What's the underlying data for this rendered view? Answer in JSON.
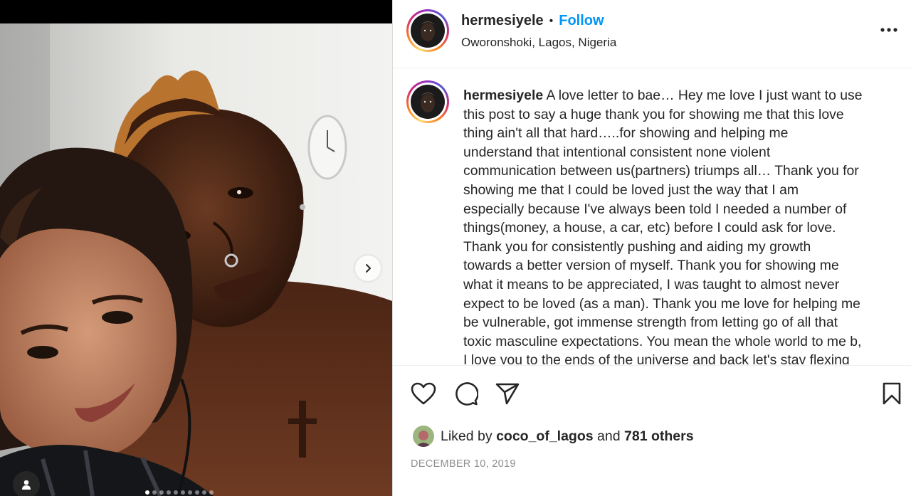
{
  "post": {
    "username": "hermesiyele",
    "follow_label": "Follow",
    "separator": "•",
    "location": "Oworonshoki, Lagos, Nigeria",
    "caption_text": "A love letter to bae… Hey me love I just want to use\nthis post to say a huge thank you for showing me that this love\nthing ain't all that hard…..for showing and helping me\nunderstand that intentional consistent none violent\ncommunication between us(partners) triumps all… Thank you for\nshowing me that I could be loved just the way that I am\nespecially because I've always been told I needed a number of\nthings(money, a house, a car, etc) before I could ask for love.\nThank you for consistently pushing and aiding my growth\ntowards a better version of myself. Thank you for showing me\nwhat it means to be appreciated, I was taught to almost never\nexpect to be loved (as a man). Thank you me love for helping me\nbe vulnerable, got immense strength from letting go of all that\ntoxic masculine expectations. You mean the whole world to me b,\nI love you to the ends of the universe and back let's stay flexing",
    "liked_by_prefix": "Liked by",
    "liked_by_user": "coco_of_lagos",
    "liked_by_and": "and",
    "liked_by_others": "781 others",
    "date": "DECEMBER 10, 2019"
  },
  "carousel": {
    "dot_count": 10,
    "active_index": 0
  },
  "icons": {
    "more": "more-horizontal-icon",
    "like": "heart-icon",
    "comment": "comment-icon",
    "share": "paper-plane-icon",
    "save": "bookmark-icon",
    "next": "chevron-right-icon",
    "tag": "user-tag-icon"
  },
  "colors": {
    "follow_blue": "#0095f6",
    "text": "#262626",
    "muted": "#8e8e8e"
  }
}
